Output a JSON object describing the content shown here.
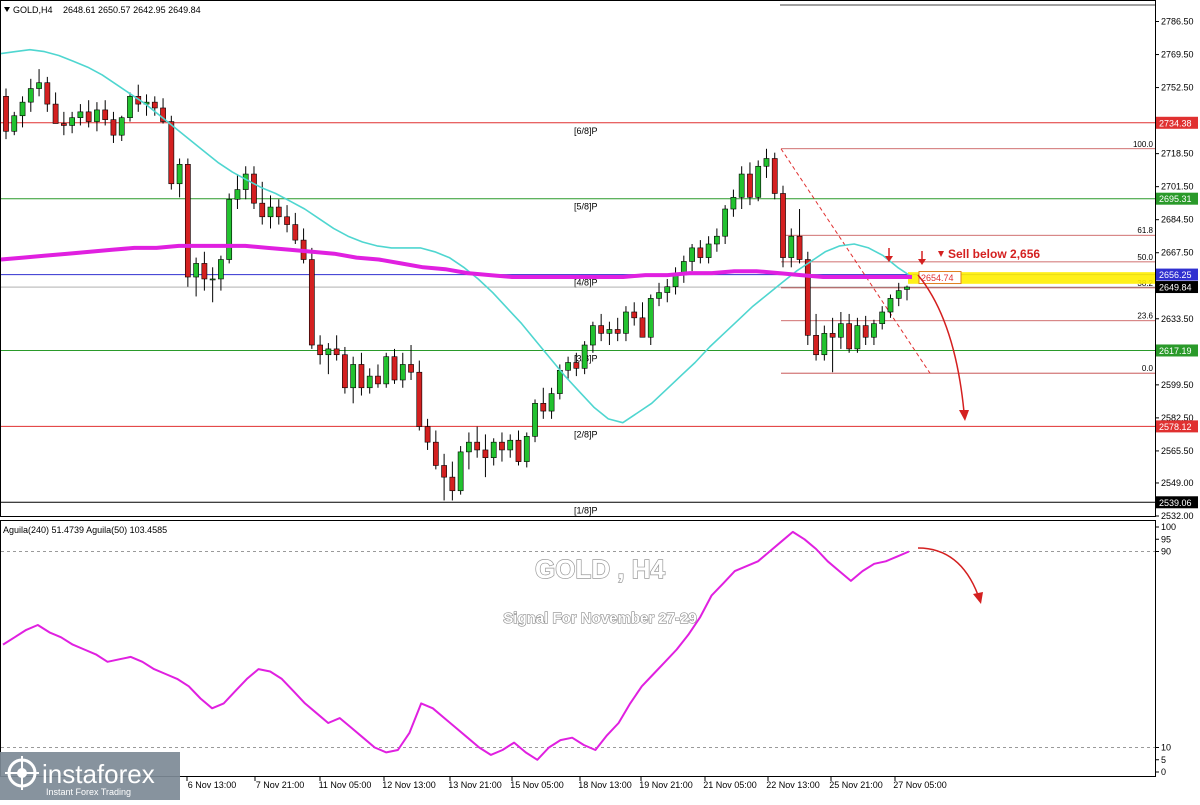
{
  "header": {
    "symbol": "GOLD,H4",
    "ohlc": "2648.61 2650.57 2642.95 2649.84"
  },
  "overlay": {
    "title": "GOLD , H4",
    "subtitle": "Signal For November 27-29",
    "sell_label": "Sell below 2,656",
    "current_price_box": "2654.74"
  },
  "indicator": {
    "label": "Aguila(240) 51.4739  Aguila(50) 103.4585",
    "scale_labels": [
      "100",
      "95",
      "90",
      "10",
      "5",
      "0"
    ]
  },
  "watermark": {
    "brand": "instaforex",
    "tagline": "Instant Forex Trading"
  },
  "colors": {
    "bull_candle": "#22c22f",
    "bear_candle": "#d42020",
    "ema_fast": "#4fd6d0",
    "ema_slow": "#e020e0",
    "murrey_red": "#e03030",
    "murrey_green": "#2a9a2a",
    "murrey_blue": "#3030d0",
    "fib": "#c04040",
    "highlight": "#ffee00"
  },
  "chart_data": {
    "type": "candlestick",
    "ylim": [
      2532.0,
      2795.0
    ],
    "price_ticks": [
      "2786.50",
      "2769.50",
      "2752.50",
      "2735.50",
      "2718.50",
      "2701.50",
      "2684.50",
      "2667.50",
      "2650.50",
      "2633.50",
      "2616.50",
      "2599.50",
      "2582.50",
      "2565.50",
      "2549.00",
      "2532.00"
    ],
    "x_labels": [
      "6 Nov 13:00",
      "7 Nov 21:00",
      "11 Nov 05:00",
      "12 Nov 13:00",
      "13 Nov 21:00",
      "15 Nov 05:00",
      "18 Nov 13:00",
      "19 Nov 21:00",
      "21 Nov 05:00",
      "22 Nov 13:00",
      "25 Nov 21:00",
      "27 Nov 05:00"
    ],
    "price_boxes": [
      {
        "label": "2734.38",
        "value": 2734.38,
        "color": "#e03030"
      },
      {
        "label": "2695.31",
        "value": 2695.31,
        "color": "#2a9a2a"
      },
      {
        "label": "2656.25",
        "value": 2656.25,
        "color": "#3030d0"
      },
      {
        "label": "2649.84",
        "value": 2649.84,
        "color": "#000000"
      },
      {
        "label": "2617.19",
        "value": 2617.19,
        "color": "#2a9a2a"
      },
      {
        "label": "2578.12",
        "value": 2578.12,
        "color": "#e03030"
      },
      {
        "label": "2539.06",
        "value": 2539.06,
        "color": "#000000"
      }
    ],
    "murrey_labels": [
      {
        "label": "[6/8]P",
        "value": 2734.38
      },
      {
        "label": "[5/8]P",
        "value": 2695.31
      },
      {
        "label": "[4/8]P",
        "value": 2656.25
      },
      {
        "label": "[3/8]P",
        "value": 2617.19
      },
      {
        "label": "[2/8]P",
        "value": 2578.12
      },
      {
        "label": "[1/8]P",
        "value": 2539.06
      }
    ],
    "fib_levels": [
      {
        "label": "100.0",
        "value": 2721.0
      },
      {
        "label": "61.8",
        "value": 2676.5
      },
      {
        "label": "50.0",
        "value": 2662.8
      },
      {
        "label": "38.2",
        "value": 2649.4
      },
      {
        "label": "23.6",
        "value": 2632.5
      },
      {
        "label": "0.0",
        "value": 2605.5
      }
    ],
    "candles": [
      {
        "o": 2748,
        "h": 2752,
        "l": 2726,
        "c": 2730
      },
      {
        "o": 2730,
        "h": 2740,
        "l": 2728,
        "c": 2738
      },
      {
        "o": 2738,
        "h": 2748,
        "l": 2732,
        "c": 2745
      },
      {
        "o": 2745,
        "h": 2757,
        "l": 2740,
        "c": 2752
      },
      {
        "o": 2752,
        "h": 2762,
        "l": 2748,
        "c": 2755
      },
      {
        "o": 2755,
        "h": 2758,
        "l": 2740,
        "c": 2744
      },
      {
        "o": 2744,
        "h": 2750,
        "l": 2734,
        "c": 2734
      },
      {
        "o": 2734,
        "h": 2740,
        "l": 2728,
        "c": 2733
      },
      {
        "o": 2733,
        "h": 2740,
        "l": 2729,
        "c": 2737
      },
      {
        "o": 2737,
        "h": 2744,
        "l": 2733,
        "c": 2740
      },
      {
        "o": 2740,
        "h": 2746,
        "l": 2732,
        "c": 2735
      },
      {
        "o": 2735,
        "h": 2745,
        "l": 2730,
        "c": 2741
      },
      {
        "o": 2741,
        "h": 2746,
        "l": 2733,
        "c": 2736
      },
      {
        "o": 2736,
        "h": 2740,
        "l": 2724,
        "c": 2728
      },
      {
        "o": 2728,
        "h": 2738,
        "l": 2725,
        "c": 2737
      },
      {
        "o": 2737,
        "h": 2750,
        "l": 2735,
        "c": 2748
      },
      {
        "o": 2748,
        "h": 2754,
        "l": 2740,
        "c": 2744
      },
      {
        "o": 2744,
        "h": 2749,
        "l": 2738,
        "c": 2745
      },
      {
        "o": 2745,
        "h": 2748,
        "l": 2738,
        "c": 2742
      },
      {
        "o": 2742,
        "h": 2747,
        "l": 2734,
        "c": 2735
      },
      {
        "o": 2735,
        "h": 2738,
        "l": 2700,
        "c": 2703
      },
      {
        "o": 2703,
        "h": 2716,
        "l": 2696,
        "c": 2713
      },
      {
        "o": 2713,
        "h": 2716,
        "l": 2650,
        "c": 2655
      },
      {
        "o": 2655,
        "h": 2665,
        "l": 2645,
        "c": 2662
      },
      {
        "o": 2662,
        "h": 2668,
        "l": 2648,
        "c": 2654
      },
      {
        "o": 2654,
        "h": 2660,
        "l": 2642,
        "c": 2654
      },
      {
        "o": 2654,
        "h": 2666,
        "l": 2648,
        "c": 2664
      },
      {
        "o": 2664,
        "h": 2698,
        "l": 2662,
        "c": 2695
      },
      {
        "o": 2695,
        "h": 2708,
        "l": 2690,
        "c": 2700
      },
      {
        "o": 2700,
        "h": 2712,
        "l": 2695,
        "c": 2708
      },
      {
        "o": 2708,
        "h": 2712,
        "l": 2690,
        "c": 2693
      },
      {
        "o": 2693,
        "h": 2704,
        "l": 2682,
        "c": 2686
      },
      {
        "o": 2686,
        "h": 2697,
        "l": 2680,
        "c": 2691
      },
      {
        "o": 2691,
        "h": 2695,
        "l": 2682,
        "c": 2686
      },
      {
        "o": 2686,
        "h": 2692,
        "l": 2678,
        "c": 2682
      },
      {
        "o": 2682,
        "h": 2688,
        "l": 2672,
        "c": 2674
      },
      {
        "o": 2674,
        "h": 2680,
        "l": 2662,
        "c": 2664
      },
      {
        "o": 2664,
        "h": 2670,
        "l": 2618,
        "c": 2620
      },
      {
        "o": 2620,
        "h": 2625,
        "l": 2610,
        "c": 2615
      },
      {
        "o": 2615,
        "h": 2621,
        "l": 2605,
        "c": 2618
      },
      {
        "o": 2618,
        "h": 2625,
        "l": 2612,
        "c": 2615
      },
      {
        "o": 2615,
        "h": 2619,
        "l": 2595,
        "c": 2598
      },
      {
        "o": 2598,
        "h": 2614,
        "l": 2590,
        "c": 2610
      },
      {
        "o": 2610,
        "h": 2616,
        "l": 2594,
        "c": 2598
      },
      {
        "o": 2598,
        "h": 2608,
        "l": 2595,
        "c": 2604
      },
      {
        "o": 2604,
        "h": 2610,
        "l": 2598,
        "c": 2600
      },
      {
        "o": 2600,
        "h": 2616,
        "l": 2598,
        "c": 2614
      },
      {
        "o": 2614,
        "h": 2618,
        "l": 2600,
        "c": 2602
      },
      {
        "o": 2602,
        "h": 2616,
        "l": 2598,
        "c": 2610
      },
      {
        "o": 2610,
        "h": 2620,
        "l": 2602,
        "c": 2606
      },
      {
        "o": 2606,
        "h": 2612,
        "l": 2576,
        "c": 2578
      },
      {
        "o": 2578,
        "h": 2582,
        "l": 2566,
        "c": 2570
      },
      {
        "o": 2570,
        "h": 2576,
        "l": 2556,
        "c": 2558
      },
      {
        "o": 2558,
        "h": 2564,
        "l": 2540,
        "c": 2552
      },
      {
        "o": 2552,
        "h": 2560,
        "l": 2540,
        "c": 2545
      },
      {
        "o": 2545,
        "h": 2568,
        "l": 2543,
        "c": 2565
      },
      {
        "o": 2565,
        "h": 2575,
        "l": 2556,
        "c": 2570
      },
      {
        "o": 2570,
        "h": 2578,
        "l": 2562,
        "c": 2566
      },
      {
        "o": 2566,
        "h": 2574,
        "l": 2552,
        "c": 2562
      },
      {
        "o": 2562,
        "h": 2572,
        "l": 2558,
        "c": 2570
      },
      {
        "o": 2570,
        "h": 2575,
        "l": 2560,
        "c": 2566
      },
      {
        "o": 2566,
        "h": 2574,
        "l": 2562,
        "c": 2571
      },
      {
        "o": 2571,
        "h": 2576,
        "l": 2558,
        "c": 2560
      },
      {
        "o": 2560,
        "h": 2575,
        "l": 2557,
        "c": 2573
      },
      {
        "o": 2573,
        "h": 2592,
        "l": 2570,
        "c": 2590
      },
      {
        "o": 2590,
        "h": 2598,
        "l": 2582,
        "c": 2586
      },
      {
        "o": 2586,
        "h": 2598,
        "l": 2582,
        "c": 2595
      },
      {
        "o": 2595,
        "h": 2610,
        "l": 2592,
        "c": 2607
      },
      {
        "o": 2607,
        "h": 2614,
        "l": 2602,
        "c": 2611
      },
      {
        "o": 2611,
        "h": 2616,
        "l": 2604,
        "c": 2608
      },
      {
        "o": 2608,
        "h": 2622,
        "l": 2605,
        "c": 2620
      },
      {
        "o": 2620,
        "h": 2632,
        "l": 2616,
        "c": 2630
      },
      {
        "o": 2630,
        "h": 2636,
        "l": 2622,
        "c": 2626
      },
      {
        "o": 2626,
        "h": 2632,
        "l": 2620,
        "c": 2628
      },
      {
        "o": 2628,
        "h": 2634,
        "l": 2622,
        "c": 2626
      },
      {
        "o": 2626,
        "h": 2640,
        "l": 2622,
        "c": 2637
      },
      {
        "o": 2637,
        "h": 2642,
        "l": 2630,
        "c": 2634
      },
      {
        "o": 2634,
        "h": 2642,
        "l": 2630,
        "c": 2624
      },
      {
        "o": 2624,
        "h": 2646,
        "l": 2620,
        "c": 2644
      },
      {
        "o": 2644,
        "h": 2652,
        "l": 2640,
        "c": 2647
      },
      {
        "o": 2647,
        "h": 2654,
        "l": 2642,
        "c": 2650
      },
      {
        "o": 2650,
        "h": 2660,
        "l": 2646,
        "c": 2656
      },
      {
        "o": 2656,
        "h": 2666,
        "l": 2652,
        "c": 2663
      },
      {
        "o": 2663,
        "h": 2672,
        "l": 2658,
        "c": 2670
      },
      {
        "o": 2670,
        "h": 2674,
        "l": 2662,
        "c": 2665
      },
      {
        "o": 2665,
        "h": 2676,
        "l": 2662,
        "c": 2672
      },
      {
        "o": 2672,
        "h": 2680,
        "l": 2668,
        "c": 2676
      },
      {
        "o": 2676,
        "h": 2692,
        "l": 2672,
        "c": 2690
      },
      {
        "o": 2690,
        "h": 2700,
        "l": 2686,
        "c": 2696
      },
      {
        "o": 2696,
        "h": 2712,
        "l": 2690,
        "c": 2708
      },
      {
        "o": 2708,
        "h": 2714,
        "l": 2692,
        "c": 2696
      },
      {
        "o": 2696,
        "h": 2715,
        "l": 2694,
        "c": 2712
      },
      {
        "o": 2712,
        "h": 2721,
        "l": 2706,
        "c": 2716
      },
      {
        "o": 2716,
        "h": 2719,
        "l": 2695,
        "c": 2698
      },
      {
        "o": 2698,
        "h": 2702,
        "l": 2660,
        "c": 2665
      },
      {
        "o": 2665,
        "h": 2680,
        "l": 2660,
        "c": 2676
      },
      {
        "o": 2676,
        "h": 2690,
        "l": 2662,
        "c": 2664
      },
      {
        "o": 2664,
        "h": 2668,
        "l": 2620,
        "c": 2625
      },
      {
        "o": 2625,
        "h": 2636,
        "l": 2612,
        "c": 2615
      },
      {
        "o": 2615,
        "h": 2630,
        "l": 2612,
        "c": 2626
      },
      {
        "o": 2626,
        "h": 2634,
        "l": 2606,
        "c": 2624
      },
      {
        "o": 2624,
        "h": 2637,
        "l": 2618,
        "c": 2631
      },
      {
        "o": 2631,
        "h": 2636,
        "l": 2616,
        "c": 2618
      },
      {
        "o": 2618,
        "h": 2634,
        "l": 2616,
        "c": 2630
      },
      {
        "o": 2630,
        "h": 2635,
        "l": 2620,
        "c": 2624
      },
      {
        "o": 2624,
        "h": 2633,
        "l": 2620,
        "c": 2631
      },
      {
        "o": 2631,
        "h": 2640,
        "l": 2628,
        "c": 2637
      },
      {
        "o": 2637,
        "h": 2646,
        "l": 2634,
        "c": 2644
      },
      {
        "o": 2644,
        "h": 2652,
        "l": 2640,
        "c": 2648
      },
      {
        "o": 2648.61,
        "h": 2650.57,
        "l": 2642.95,
        "c": 2649.84
      }
    ],
    "ema_fast": [
      2770,
      2771,
      2772,
      2771,
      2769,
      2766,
      2763,
      2759,
      2754,
      2749,
      2744,
      2738,
      2732,
      2726,
      2720,
      2714,
      2709,
      2705,
      2701,
      2698,
      2694,
      2690,
      2685,
      2680,
      2676,
      2673,
      2671,
      2670,
      2670,
      2670,
      2668,
      2665,
      2660,
      2654,
      2647,
      2639,
      2631,
      2622,
      2613,
      2604,
      2596,
      2588,
      2582,
      2580,
      2585,
      2590,
      2597,
      2604,
      2611,
      2619,
      2626,
      2633,
      2640,
      2646,
      2652,
      2658,
      2663,
      2668,
      2671,
      2672,
      2670,
      2666,
      2660,
      2655
    ],
    "ema_slow": [
      2664,
      2665,
      2666,
      2667,
      2668,
      2669,
      2670,
      2670,
      2671,
      2671,
      2671,
      2671,
      2670,
      2669,
      2668,
      2667,
      2665,
      2664,
      2662,
      2660,
      2659,
      2657,
      2656,
      2655,
      2655,
      2655,
      2655,
      2655,
      2655,
      2656,
      2656,
      2657,
      2657,
      2658,
      2658,
      2657,
      2656,
      2655,
      2655,
      2655,
      2655,
      2655
    ],
    "indicator_ylim": [
      0,
      100
    ],
    "aguila_line": [
      52,
      55,
      58,
      60,
      57,
      55,
      52,
      50,
      48,
      45,
      46,
      47,
      45,
      42,
      40,
      38,
      35,
      30,
      26,
      28,
      33,
      38,
      42,
      41,
      38,
      33,
      28,
      24,
      20,
      22,
      18,
      14,
      10,
      8,
      9,
      16,
      28,
      26,
      22,
      18,
      14,
      10,
      7,
      9,
      12,
      8,
      5,
      10,
      13,
      14,
      11,
      9,
      15,
      20,
      28,
      35,
      40,
      45,
      50,
      56,
      63,
      72,
      77,
      82,
      84,
      86,
      90,
      94,
      98,
      95,
      91,
      86,
      82,
      78,
      82,
      85,
      86,
      88,
      90
    ],
    "annotations": [
      "Sell below 2,656",
      "2654.74"
    ]
  }
}
